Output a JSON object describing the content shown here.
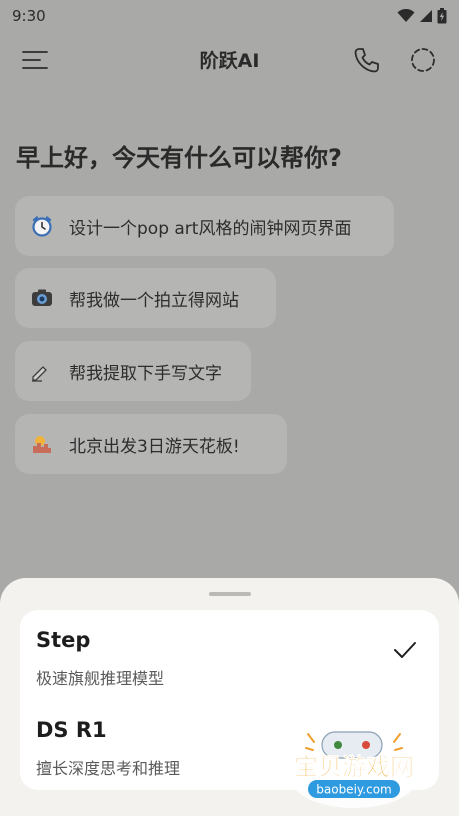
{
  "status_bar": {
    "time": "9:30"
  },
  "header": {
    "title": "阶跃AI"
  },
  "greeting": "早上好，今天有什么可以帮你?",
  "suggestions": [
    {
      "icon": "alarm-clock-icon",
      "label": "设计一个pop art风格的闹钟网页界面"
    },
    {
      "icon": "camera-icon",
      "label": "帮我做一个拍立得网站"
    },
    {
      "icon": "writing-hand-icon",
      "label": "帮我提取下手写文字"
    },
    {
      "icon": "cityscape-icon",
      "label": "北京出发3日游天花板!"
    }
  ],
  "model_sheet": {
    "options": [
      {
        "name": "Step",
        "description": "极速旗舰推理模型",
        "selected": true
      },
      {
        "name": "DS R1",
        "description": "擅长深度思考和推理",
        "selected": false
      }
    ]
  },
  "watermark": {
    "title": "宝贝游戏网",
    "url": "baobeiy.com"
  },
  "colors": {
    "scrim_background": "#a9a9a7",
    "chip_background": "#b5b5b3",
    "sheet_background": "#f3f2ee",
    "card_background": "#ffffff"
  }
}
